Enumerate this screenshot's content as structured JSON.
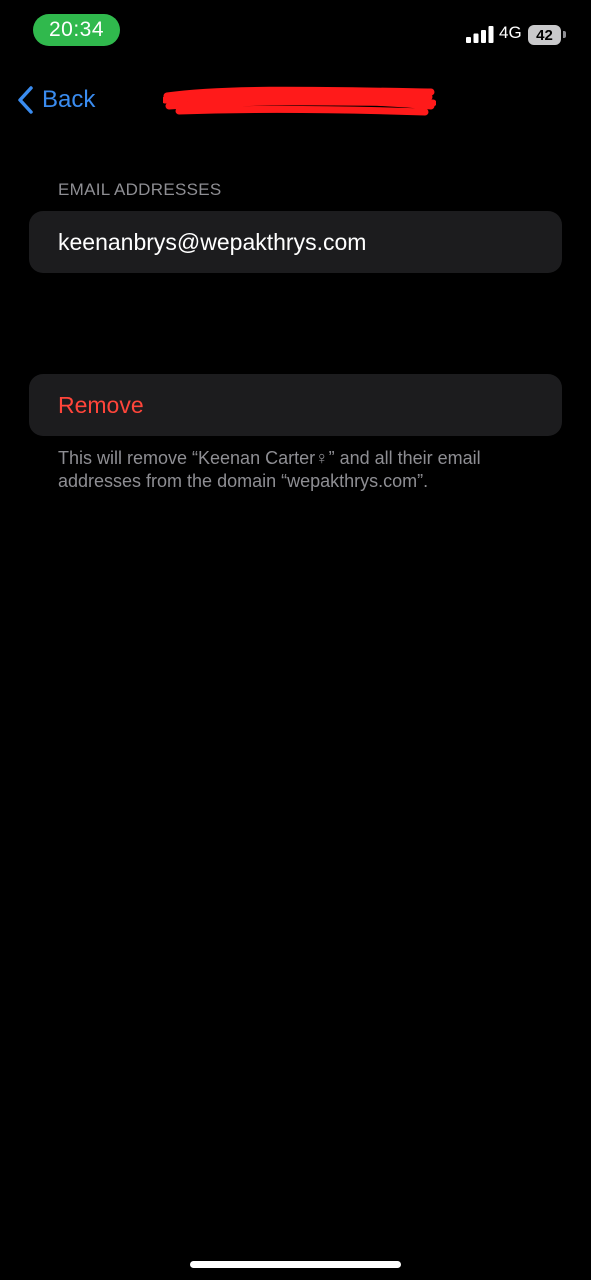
{
  "status_bar": {
    "time": "20:34",
    "network": "4G",
    "battery_level": "42",
    "time_pill_color": "#30b94d"
  },
  "nav": {
    "back_label": "Back",
    "back_icon": "chevron-left-icon",
    "accent_color": "#3a8cf0"
  },
  "email_section": {
    "header": "EMAIL ADDRESSES",
    "items": [
      "keenanbrys@wepakthrys.com"
    ]
  },
  "remove_section": {
    "button_label": "Remove",
    "destructive_color": "#ff453a",
    "footer": "This will remove “Keenan Carter♀” and all their email addresses from the domain “wepakthrys.com”."
  }
}
